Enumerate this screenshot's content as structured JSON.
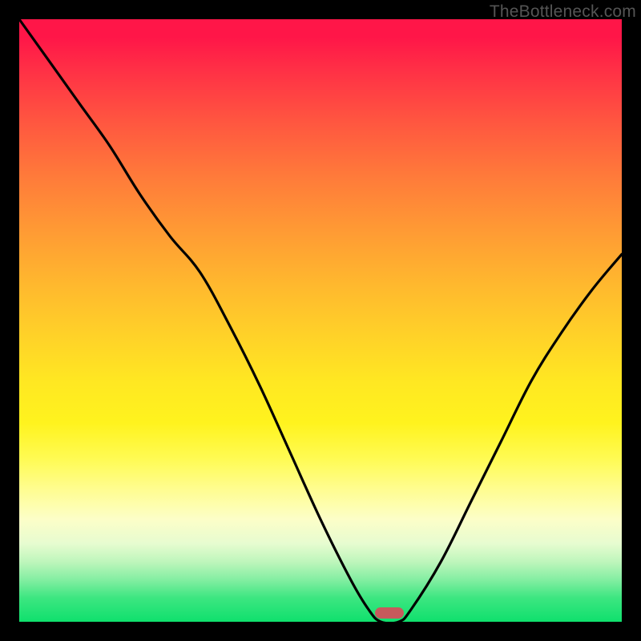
{
  "watermark": "TheBottleneck.com",
  "chart_data": {
    "type": "line",
    "title": "",
    "xlabel": "",
    "ylabel": "",
    "xlim": [
      0,
      100
    ],
    "ylim": [
      0,
      100
    ],
    "background": "heat-gradient",
    "series": [
      {
        "name": "bottleneck-curve",
        "x": [
          0,
          5,
          10,
          15,
          20,
          25,
          30,
          35,
          40,
          45,
          50,
          55,
          58,
          60,
          63,
          65,
          70,
          75,
          80,
          85,
          90,
          95,
          100
        ],
        "values": [
          100,
          93,
          86,
          79,
          71,
          64,
          58,
          49,
          39,
          28,
          17,
          7,
          2,
          0,
          0,
          2,
          10,
          20,
          30,
          40,
          48,
          55,
          61
        ]
      }
    ],
    "marker": {
      "x": 61.5,
      "y": 1.5,
      "color": "#c75a5c",
      "shape": "pill"
    }
  },
  "colors": {
    "frame": "#000000",
    "curve": "#000000",
    "marker": "#c75a5c",
    "watermark": "#555555"
  }
}
